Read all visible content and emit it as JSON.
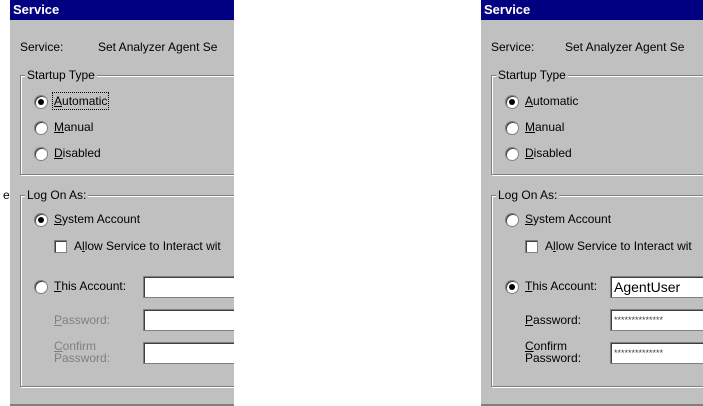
{
  "dialogs": [
    {
      "title": "Service",
      "service_label": "Service:",
      "service_name": "Set Analyzer Agent Se",
      "startup_group": "Startup Type",
      "startup_options": [
        {
          "hotkey": "A",
          "rest": "utomatic",
          "selected": true
        },
        {
          "hotkey": "M",
          "rest": "anual",
          "selected": false
        },
        {
          "hotkey": "D",
          "rest": "isabled",
          "selected": false
        }
      ],
      "logon_group": "Log On As:",
      "system_account": {
        "hotkey": "S",
        "rest": "ystem Account",
        "selected": true
      },
      "interact": {
        "pre": "A",
        "hotkey": "l",
        "rest": "low Service to Interact wit",
        "checked": false
      },
      "this_account": {
        "hotkey": "T",
        "rest": "his Account:",
        "selected": false,
        "value": ""
      },
      "password": {
        "hotkey": "P",
        "rest": "assword:",
        "value": ""
      },
      "confirm": {
        "hotkey": "C",
        "line1_rest": "onfirm",
        "line2": "Password:",
        "value": ""
      }
    },
    {
      "title": "Service",
      "service_label": "Service:",
      "service_name": "Set Analyzer Agent Se",
      "startup_group": "Startup Type",
      "startup_options": [
        {
          "hotkey": "A",
          "rest": "utomatic",
          "selected": true
        },
        {
          "hotkey": "M",
          "rest": "anual",
          "selected": false
        },
        {
          "hotkey": "D",
          "rest": "isabled",
          "selected": false
        }
      ],
      "logon_group": "Log On As:",
      "system_account": {
        "hotkey": "S",
        "rest": "ystem Account",
        "selected": false
      },
      "interact": {
        "pre": "A",
        "hotkey": "l",
        "rest": "low Service to Interact wit",
        "checked": false
      },
      "this_account": {
        "hotkey": "T",
        "rest": "his Account:",
        "selected": true,
        "value": "AgentUser"
      },
      "password": {
        "hotkey": "P",
        "rest": "assword:",
        "value": "**************"
      },
      "confirm": {
        "hotkey": "C",
        "line1_rest": "onfirm",
        "line2": "Password:",
        "value": "**************"
      }
    }
  ],
  "stray_left_char": "e"
}
